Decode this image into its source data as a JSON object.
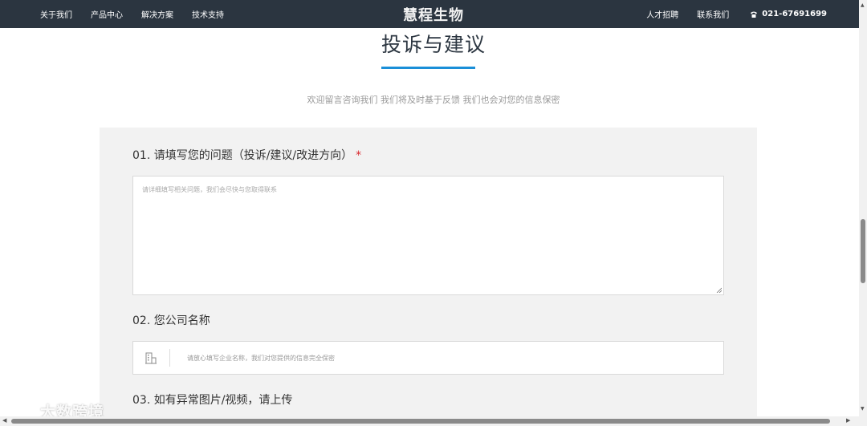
{
  "nav": {
    "left": [
      "关于我们",
      "产品中心",
      "解决方案",
      "技术支持"
    ],
    "brand": "慧程生物",
    "right": [
      "人才招聘",
      "联系我们"
    ],
    "phone": "021-67691699"
  },
  "section": {
    "title": "投诉与建议",
    "subtitle": "欢迎留言咨询我们 我们将及时基于反馈 我们也会对您的信息保密"
  },
  "form": {
    "q1": {
      "label": "01. 请填写您的问题（投诉/建议/改进方向）",
      "required_mark": "*",
      "placeholder": "请详细填写相关问题，我们会尽快与您取得联系"
    },
    "q2": {
      "label": "02. 您公司名称",
      "placeholder": "请放心填写企业名称，我们对您提供的信息完全保密"
    },
    "q3": {
      "label": "03. 如有异常图片/视频，请上传"
    }
  },
  "watermark": {
    "text": "大数跨境"
  },
  "colors": {
    "nav_bg": "#2b3540",
    "accent": "#1a8fd8",
    "required": "#d9282e",
    "panel_bg": "#f2f2f2"
  }
}
